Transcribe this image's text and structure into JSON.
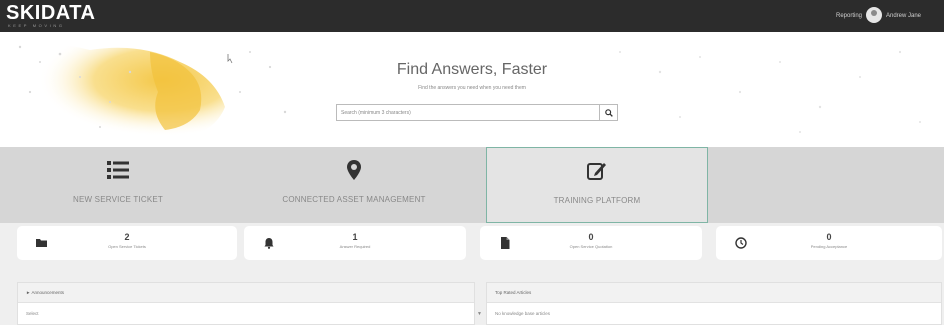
{
  "topbar": {
    "logo": "SKIDATA",
    "logo_sub": "KEEP MOVING",
    "report_link": "Reporting",
    "username": "Andrew Jane"
  },
  "hero": {
    "title": "Find Answers, Faster",
    "subtitle": "Find the answers you need when you need them",
    "search_placeholder": "Search (minimum 3 characters)"
  },
  "tiles": [
    {
      "label": "NEW SERVICE TICKET",
      "icon": "list-icon"
    },
    {
      "label": "CONNECTED ASSET MANAGEMENT",
      "icon": "map-marker-icon"
    },
    {
      "label": "TRAINING PLATFORM",
      "icon": "edit-icon"
    }
  ],
  "stats": [
    {
      "count": "2",
      "label": "Open Service Tickets",
      "icon": "folder-icon"
    },
    {
      "count": "1",
      "label": "Answer Required",
      "icon": "bell-icon"
    },
    {
      "count": "0",
      "label": "Open Service Quotation",
      "icon": "document-icon"
    },
    {
      "count": "0",
      "label": "Pending Acceptance",
      "icon": "clock-icon"
    }
  ],
  "panels": {
    "announcements": {
      "title": "Announcements",
      "select_value": "Select",
      "icon": "megaphone-icon"
    },
    "top_rated": {
      "title": "Top Rated Articles",
      "body": "No knowledge base articles"
    }
  },
  "colors": {
    "topbar": "#2c2c2c",
    "tiles_bg": "#d6d6d6",
    "active_border": "#7fb5a5",
    "map_accent": "#f5cf5b"
  }
}
